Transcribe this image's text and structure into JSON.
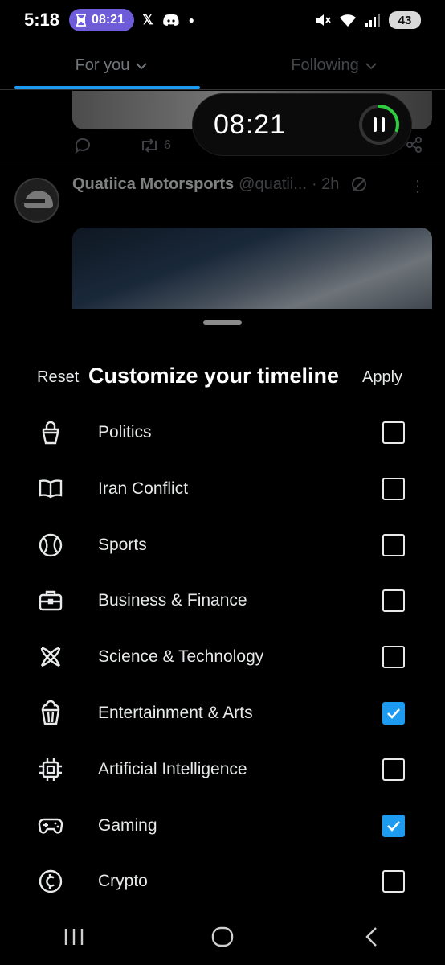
{
  "status_bar": {
    "time": "5:18",
    "timer_pill": "08:21",
    "battery": "43"
  },
  "top_tabs": [
    {
      "label": "For you",
      "active": true
    },
    {
      "label": "Following",
      "active": false
    }
  ],
  "feed": {
    "retweet_count": "6",
    "post": {
      "author": "Quatiica Motorsports",
      "handle": "@quatii...",
      "time": "· 2h"
    }
  },
  "floating_timer": {
    "time": "08:21",
    "progress": 0.3
  },
  "sheet": {
    "reset_label": "Reset",
    "title": "Customize your timeline",
    "apply_label": "Apply",
    "topics": [
      {
        "label": "Politics",
        "icon": "podium-icon",
        "checked": false
      },
      {
        "label": "Iran Conflict",
        "icon": "book-icon",
        "checked": false
      },
      {
        "label": "Sports",
        "icon": "tennis-ball-icon",
        "checked": false
      },
      {
        "label": "Business & Finance",
        "icon": "briefcase-icon",
        "checked": false
      },
      {
        "label": "Science & Technology",
        "icon": "atom-icon",
        "checked": false
      },
      {
        "label": "Entertainment & Arts",
        "icon": "popcorn-icon",
        "checked": true
      },
      {
        "label": "Artificial Intelligence",
        "icon": "chip-icon",
        "checked": false
      },
      {
        "label": "Gaming",
        "icon": "gamepad-icon",
        "checked": true
      },
      {
        "label": "Crypto",
        "icon": "crypto-coin-icon",
        "checked": false
      }
    ]
  },
  "colors": {
    "accent": "#1d9bf0",
    "timer_pill": "#6e5bd8",
    "timer_progress": "#2ecc40"
  }
}
